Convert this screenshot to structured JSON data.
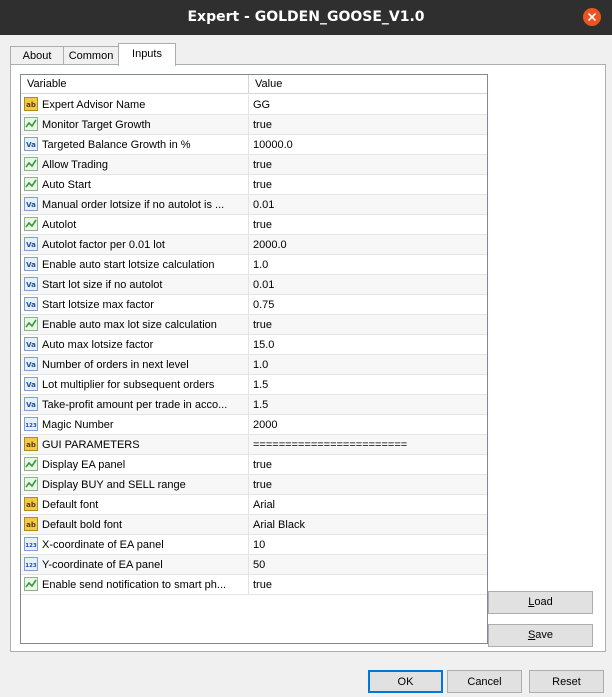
{
  "window": {
    "title": "Expert - GOLDEN_GOOSE_V1.0"
  },
  "tabs": [
    {
      "label": "About"
    },
    {
      "label": "Common"
    },
    {
      "label": "Inputs"
    }
  ],
  "table": {
    "headers": {
      "variable": "Variable",
      "value": "Value"
    },
    "rows": [
      {
        "name": "Expert Advisor Name",
        "value": "GG",
        "icon": "string-icon"
      },
      {
        "name": "Monitor Target Growth",
        "value": "true",
        "icon": "bool-icon"
      },
      {
        "name": "Targeted Balance Growth in %",
        "value": "10000.0",
        "icon": "double-icon"
      },
      {
        "name": "Allow Trading",
        "value": "true",
        "icon": "bool-icon"
      },
      {
        "name": "Auto Start",
        "value": "true",
        "icon": "bool-icon"
      },
      {
        "name": "Manual order lotsize if no autolot is ...",
        "value": "0.01",
        "icon": "double-icon"
      },
      {
        "name": "Autolot",
        "value": "true",
        "icon": "bool-icon"
      },
      {
        "name": "Autolot factor per 0.01 lot",
        "value": "2000.0",
        "icon": "double-icon"
      },
      {
        "name": "Enable auto start lotsize calculation",
        "value": "1.0",
        "icon": "double-icon"
      },
      {
        "name": "Start lot size if no autolot",
        "value": "0.01",
        "icon": "double-icon"
      },
      {
        "name": "Start lotsize max factor",
        "value": "0.75",
        "icon": "double-icon"
      },
      {
        "name": "Enable auto max lot size calculation",
        "value": "true",
        "icon": "bool-icon"
      },
      {
        "name": "Auto max lotsize factor",
        "value": "15.0",
        "icon": "double-icon"
      },
      {
        "name": "Number of orders in next level",
        "value": "1.0",
        "icon": "double-icon"
      },
      {
        "name": "Lot multiplier for subsequent orders",
        "value": "1.5",
        "icon": "double-icon"
      },
      {
        "name": "Take-profit amount per trade in acco...",
        "value": "1.5",
        "icon": "double-icon"
      },
      {
        "name": "Magic Number",
        "value": "2000",
        "icon": "int-icon"
      },
      {
        "name": "GUI PARAMETERS",
        "value": "========================",
        "icon": "string-icon"
      },
      {
        "name": "Display EA panel",
        "value": "true",
        "icon": "bool-icon"
      },
      {
        "name": "Display BUY and SELL range",
        "value": "true",
        "icon": "bool-icon"
      },
      {
        "name": "Default font",
        "value": "Arial",
        "icon": "string-icon"
      },
      {
        "name": "Default bold font",
        "value": "Arial Black",
        "icon": "string-icon"
      },
      {
        "name": "X-coordinate of EA panel",
        "value": "10",
        "icon": "int-icon"
      },
      {
        "name": "Y-coordinate of EA panel",
        "value": "50",
        "icon": "int-icon"
      },
      {
        "name": "Enable send notification to smart ph...",
        "value": "true",
        "icon": "bool-icon"
      }
    ]
  },
  "buttons": {
    "load": {
      "first": "L",
      "rest": "oad"
    },
    "save": {
      "first": "S",
      "rest": "ave"
    },
    "ok": "OK",
    "cancel": "Cancel",
    "reset": "Reset"
  },
  "icon_glyphs": {
    "string": "ab",
    "double": "Va",
    "int": "123"
  },
  "colors": {
    "titlebar": "#2f2f2f",
    "close": "#e95420",
    "focus": "#0078d7",
    "string_icon": "#f2c94c",
    "bool_icon": "#3a9a3a",
    "num_icon": "#4a8fd8"
  }
}
